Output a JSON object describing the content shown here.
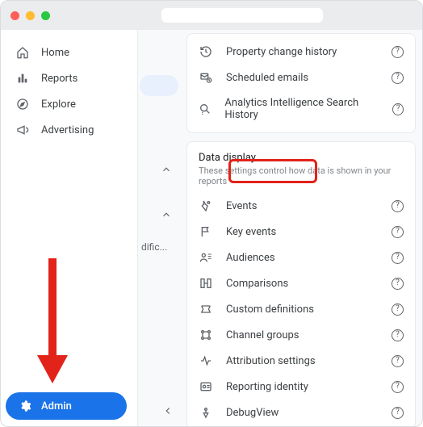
{
  "sidebar": {
    "items": [
      {
        "label": "Home"
      },
      {
        "label": "Reports"
      },
      {
        "label": "Explore"
      },
      {
        "label": "Advertising"
      }
    ],
    "admin_label": "Admin"
  },
  "partial": {
    "truncated_label": "dific..."
  },
  "property_card": {
    "rows": [
      {
        "label": "Property change history"
      },
      {
        "label": "Scheduled emails"
      },
      {
        "label": "Analytics Intelligence Search History"
      }
    ]
  },
  "data_display": {
    "title": "Data display",
    "subtitle": "These settings control how data is shown in your reports",
    "rows": [
      {
        "label": "Events"
      },
      {
        "label": "Key events"
      },
      {
        "label": "Audiences"
      },
      {
        "label": "Comparisons"
      },
      {
        "label": "Custom definitions"
      },
      {
        "label": "Channel groups"
      },
      {
        "label": "Attribution settings"
      },
      {
        "label": "Reporting identity"
      },
      {
        "label": "DebugView"
      }
    ]
  }
}
